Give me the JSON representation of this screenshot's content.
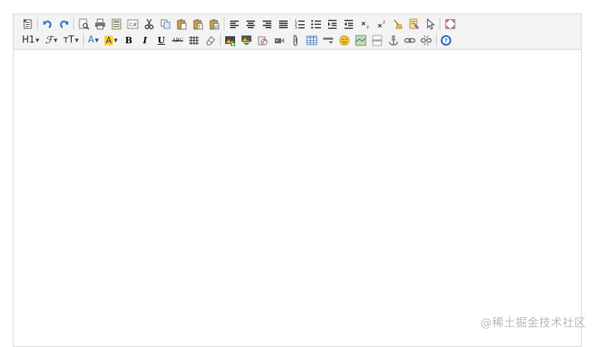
{
  "toolbar": {
    "row1": [
      {
        "name": "source-icon",
        "type": "icon"
      },
      {
        "type": "sep"
      },
      {
        "name": "undo-icon",
        "type": "icon"
      },
      {
        "name": "redo-icon",
        "type": "icon"
      },
      {
        "type": "sep"
      },
      {
        "name": "preview-icon",
        "type": "icon"
      },
      {
        "name": "print-icon",
        "type": "icon"
      },
      {
        "name": "template-icon",
        "type": "icon"
      },
      {
        "name": "code-icon",
        "type": "icon"
      },
      {
        "name": "cut-icon",
        "type": "icon"
      },
      {
        "name": "copy-icon",
        "type": "icon"
      },
      {
        "name": "paste-icon",
        "type": "icon"
      },
      {
        "name": "paste-text-icon",
        "type": "icon"
      },
      {
        "name": "paste-word-icon",
        "type": "icon"
      },
      {
        "type": "sep"
      },
      {
        "name": "align-left-icon",
        "type": "icon"
      },
      {
        "name": "align-center-icon",
        "type": "icon"
      },
      {
        "name": "align-right-icon",
        "type": "icon"
      },
      {
        "name": "align-justify-icon",
        "type": "icon"
      },
      {
        "name": "ordered-list-icon",
        "type": "icon"
      },
      {
        "name": "unordered-list-icon",
        "type": "icon"
      },
      {
        "name": "indent-icon",
        "type": "icon"
      },
      {
        "name": "outdent-icon",
        "type": "icon"
      },
      {
        "name": "subscript-icon",
        "type": "icon"
      },
      {
        "name": "superscript-icon",
        "type": "icon"
      },
      {
        "name": "clear-format-icon",
        "type": "icon"
      },
      {
        "name": "quick-format-icon",
        "type": "icon"
      },
      {
        "name": "select-all-icon",
        "type": "icon"
      },
      {
        "type": "sep"
      },
      {
        "name": "fullscreen-icon",
        "type": "icon"
      }
    ],
    "row2_text": {
      "heading": "H1",
      "font_name": "ℱ",
      "font_size": "тT",
      "font_color": "A",
      "highlight": "A",
      "bold": "B",
      "italic": "I",
      "underline": "U",
      "strike": "ABC"
    },
    "row2_icons": [
      {
        "name": "line-height-icon"
      },
      {
        "name": "remove-format-icon"
      }
    ],
    "row2_after": [
      {
        "name": "image-icon"
      },
      {
        "name": "multi-image-icon"
      },
      {
        "name": "flash-icon"
      },
      {
        "name": "media-icon"
      },
      {
        "name": "attachment-icon"
      },
      {
        "name": "table-icon"
      },
      {
        "name": "hr-icon"
      },
      {
        "name": "emoticon-icon"
      },
      {
        "name": "map-icon"
      },
      {
        "name": "page-break-icon"
      },
      {
        "name": "anchor-icon"
      },
      {
        "name": "link-icon"
      },
      {
        "name": "unlink-icon"
      },
      {
        "type": "sep"
      },
      {
        "name": "help-icon"
      }
    ]
  },
  "watermark": "@稀土掘金技术社区",
  "colors": {
    "toolbar_bg": "#f3f3f3",
    "border": "#d4d4d4",
    "highlight_yellow": "#f9d23c",
    "link_blue": "#2f6fbf"
  }
}
